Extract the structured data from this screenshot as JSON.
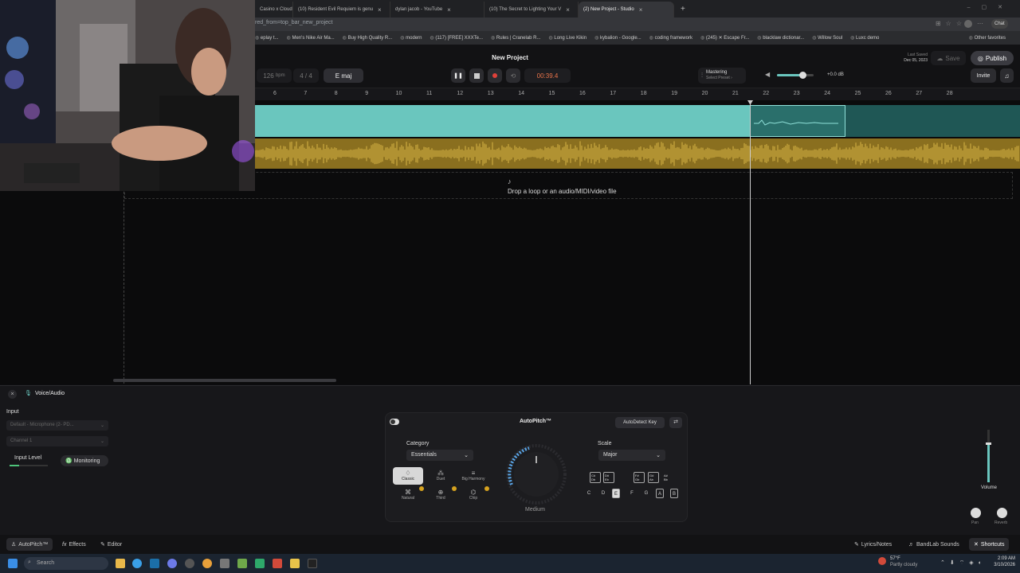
{
  "browser": {
    "tabs": [
      {
        "label": "Casino x Cloud"
      },
      {
        "label": "(10) Resident Evil Requiem is genu"
      },
      {
        "label": "dylan jacob - YouTube"
      },
      {
        "label": "(10) The Secret to Lighting Your V"
      },
      {
        "label": "(2) New Project - Studio",
        "active": true
      }
    ],
    "new_tab": "+",
    "url": "red_from=top_bar_new_project",
    "bookmarks": [
      "eplay t...",
      "Men's Nike Air Ma...",
      "Buy High Quality R...",
      "modern",
      "(117) [FREE] XXXTe...",
      "Rules | Cranelab R...",
      "Long Live Kikin",
      "kybalion - Google...",
      "coding framework",
      "(245) ✕ Escape Fr...",
      "blacklaw dictionar...",
      "Willow Soul",
      "Luxc demo"
    ],
    "other_favorites": "Other favorites",
    "chat_label": "Chat"
  },
  "header": {
    "project_title": "New Project",
    "bpm_value": "126",
    "bpm_unit": "bpm",
    "time_signature": "4 / 4",
    "key": "E maj",
    "time_display": "00:39.4",
    "mastering_label": "Mastering",
    "mastering_preset": "Select Preset ›",
    "volume_db": "+0.0 dB",
    "last_saved_label": "Last Saved",
    "last_saved_date": "Dec 05, 2023",
    "save_label": "Save",
    "publish_label": "Publish",
    "invite_label": "Invite",
    "volume_level": 0.7
  },
  "ruler": {
    "bars": [
      "6",
      "7",
      "8",
      "9",
      "10",
      "11",
      "12",
      "13",
      "14",
      "15",
      "16",
      "17",
      "18",
      "19",
      "20",
      "21",
      "22",
      "23",
      "24",
      "25",
      "26",
      "27",
      "28"
    ]
  },
  "tracks": {
    "drop_text": "Drop a loop or an audio/MIDI/video file"
  },
  "panel": {
    "title": "Voice/Audio",
    "input_label": "Input",
    "device": "Default - Microphone (2- PD...",
    "channel": "Channel 1",
    "input_level_label": "Input Level",
    "monitoring_label": "Monitoring",
    "autopitch": {
      "title": "AutoPitch™",
      "autodetect_label": "AutoDetect Key",
      "category_label": "Category",
      "category_value": "Essentials",
      "presets": [
        {
          "label": "Classic",
          "icon": "♢"
        },
        {
          "label": "Duet",
          "icon": "⁂"
        },
        {
          "label": "Big Harmony",
          "icon": "≡"
        },
        {
          "label": "Natural",
          "icon": "⌘"
        },
        {
          "label": "Third",
          "icon": "⊕"
        },
        {
          "label": "Chip",
          "icon": "⌬"
        }
      ],
      "knob_label": "Medium",
      "scale_label": "Scale",
      "scale_value": "Major",
      "sharps": [
        "C# Db",
        "D# Eb",
        "F# Gb",
        "G# Ab",
        "A# Bb"
      ],
      "naturals": [
        "C",
        "D",
        "E",
        "F",
        "G",
        "A",
        "B"
      ]
    },
    "volume_label": "Volume",
    "pan_label": "Pan",
    "reverb_label": "Reverb"
  },
  "bottom_tabs": {
    "autopitch": "AutoPitch™",
    "effects": "Effects",
    "editor": "Editor",
    "lyrics": "Lyrics/Notes",
    "bandlab": "BandLab Sounds",
    "shortcuts": "Shortcuts"
  },
  "taskbar": {
    "search_placeholder": "Search",
    "weather_temp": "57°F",
    "weather_desc": "Partly cloudy",
    "time": "2:09 AM",
    "date": "3/10/2026"
  },
  "colors": {
    "track_teal": "#6ac6be",
    "track_gold": "#8a6f1f",
    "record_red": "#e0413a",
    "timer_orange": "#e9744a",
    "autopitch_badge": "#d6a21f"
  }
}
